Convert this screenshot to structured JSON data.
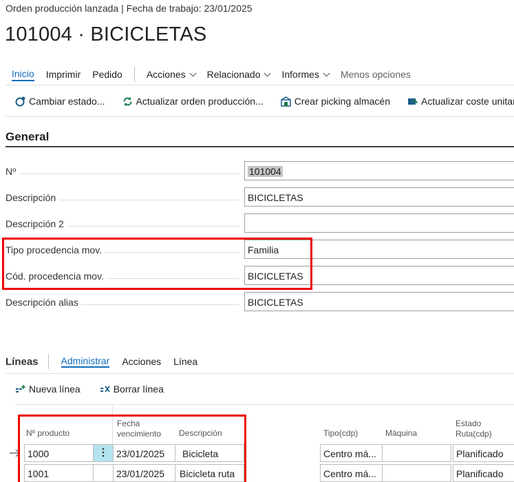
{
  "header": {
    "subtitle": "Orden producción lanzada | Fecha de trabajo: 23/01/2025",
    "title": "101004 · BICICLETAS"
  },
  "menu": {
    "inicio": "Inicio",
    "imprimir": "Imprimir",
    "pedido": "Pedido",
    "acciones": "Acciones",
    "relacionado": "Relacionado",
    "informes": "Informes",
    "menos": "Menos opciones"
  },
  "actions": {
    "cambiar": "Cambiar estado...",
    "actualizar": "Actualizar orden producción...",
    "picking": "Crear picking almacén",
    "coste": "Actualizar coste unitar"
  },
  "general": {
    "title": "General",
    "fields": [
      {
        "label": "Nº",
        "value": "101004"
      },
      {
        "label": "Descripción",
        "value": "BICICLETAS"
      },
      {
        "label": "Descripción 2",
        "value": ""
      },
      {
        "label": "Tipo procedencia mov.",
        "value": "Familia"
      },
      {
        "label": "Cód. procedencia mov.",
        "value": "BICICLETAS"
      },
      {
        "label": "Descripción alias",
        "value": "BICICLETAS"
      }
    ]
  },
  "lineas": {
    "title": "Líneas",
    "tabs": {
      "administrar": "Administrar",
      "acciones": "Acciones",
      "linea": "Línea"
    },
    "nueva": "Nueva línea",
    "borrar": "Borrar línea",
    "columns": {
      "producto": "Nº producto",
      "fecha1": "Fecha",
      "fecha2": "vencimiento",
      "descripcion": "Descripción",
      "tipo": "Tipo(cdp)",
      "maquina": "Máquina",
      "estado1": "Estado",
      "estado2": "Ruta(cdp)"
    },
    "rows": [
      {
        "producto": "1000",
        "fecha": "23/01/2025",
        "descripcion": "Bicicleta",
        "tipo": "Centro má...",
        "maquina": "",
        "estado": "Planificado"
      },
      {
        "producto": "1001",
        "fecha": "23/01/2025",
        "descripcion": "Bicicleta ruta",
        "tipo": "Centro má...",
        "maquina": "",
        "estado": "Planificado"
      }
    ]
  },
  "colors": {
    "accent": "#0f6cbd",
    "highlight": "#e00000",
    "menuCell": "#b3e3ee"
  }
}
